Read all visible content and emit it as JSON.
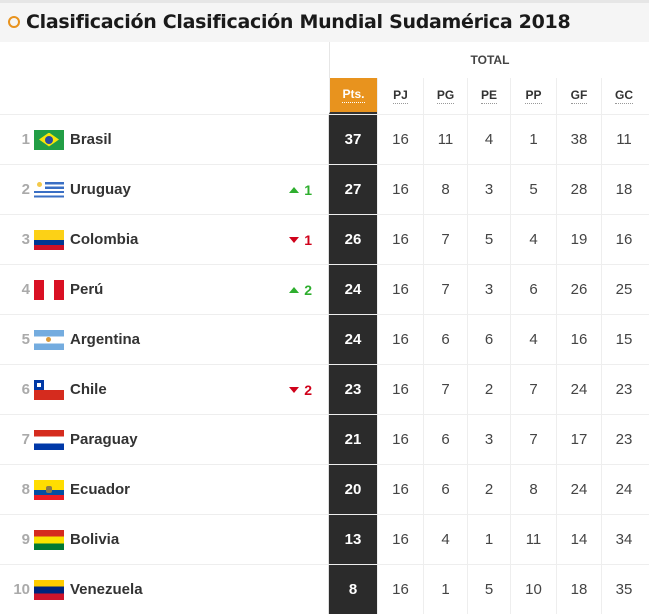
{
  "title": "Clasificación Clasificación Mundial Sudamérica 2018",
  "group_header": "TOTAL",
  "columns": [
    "Pts.",
    "PJ",
    "PG",
    "PE",
    "PP",
    "GF",
    "GC"
  ],
  "colors": {
    "accent": "#e8931e",
    "pts_bg": "#2b2b2b",
    "up": "#2eae2e",
    "down": "#d0021b"
  },
  "rows": [
    {
      "pos": "1",
      "team": "Brasil",
      "flag": "brazil",
      "trend": "",
      "trend_dir": "",
      "pts": "37",
      "pj": "16",
      "pg": "11",
      "pe": "4",
      "pp": "1",
      "gf": "38",
      "gc": "11"
    },
    {
      "pos": "2",
      "team": "Uruguay",
      "flag": "uruguay",
      "trend": "1",
      "trend_dir": "up",
      "pts": "27",
      "pj": "16",
      "pg": "8",
      "pe": "3",
      "pp": "5",
      "gf": "28",
      "gc": "18"
    },
    {
      "pos": "3",
      "team": "Colombia",
      "flag": "colombia",
      "trend": "1",
      "trend_dir": "down",
      "pts": "26",
      "pj": "16",
      "pg": "7",
      "pe": "5",
      "pp": "4",
      "gf": "19",
      "gc": "16"
    },
    {
      "pos": "4",
      "team": "Perú",
      "flag": "peru",
      "trend": "2",
      "trend_dir": "up",
      "pts": "24",
      "pj": "16",
      "pg": "7",
      "pe": "3",
      "pp": "6",
      "gf": "26",
      "gc": "25"
    },
    {
      "pos": "5",
      "team": "Argentina",
      "flag": "argentina",
      "trend": "",
      "trend_dir": "",
      "pts": "24",
      "pj": "16",
      "pg": "6",
      "pe": "6",
      "pp": "4",
      "gf": "16",
      "gc": "15"
    },
    {
      "pos": "6",
      "team": "Chile",
      "flag": "chile",
      "trend": "2",
      "trend_dir": "down",
      "pts": "23",
      "pj": "16",
      "pg": "7",
      "pe": "2",
      "pp": "7",
      "gf": "24",
      "gc": "23"
    },
    {
      "pos": "7",
      "team": "Paraguay",
      "flag": "paraguay",
      "trend": "",
      "trend_dir": "",
      "pts": "21",
      "pj": "16",
      "pg": "6",
      "pe": "3",
      "pp": "7",
      "gf": "17",
      "gc": "23"
    },
    {
      "pos": "8",
      "team": "Ecuador",
      "flag": "ecuador",
      "trend": "",
      "trend_dir": "",
      "pts": "20",
      "pj": "16",
      "pg": "6",
      "pe": "2",
      "pp": "8",
      "gf": "24",
      "gc": "24"
    },
    {
      "pos": "9",
      "team": "Bolivia",
      "flag": "bolivia",
      "trend": "",
      "trend_dir": "",
      "pts": "13",
      "pj": "16",
      "pg": "4",
      "pe": "1",
      "pp": "11",
      "gf": "14",
      "gc": "34"
    },
    {
      "pos": "10",
      "team": "Venezuela",
      "flag": "venezuela",
      "trend": "",
      "trend_dir": "",
      "pts": "8",
      "pj": "16",
      "pg": "1",
      "pe": "5",
      "pp": "10",
      "gf": "18",
      "gc": "35"
    }
  ]
}
